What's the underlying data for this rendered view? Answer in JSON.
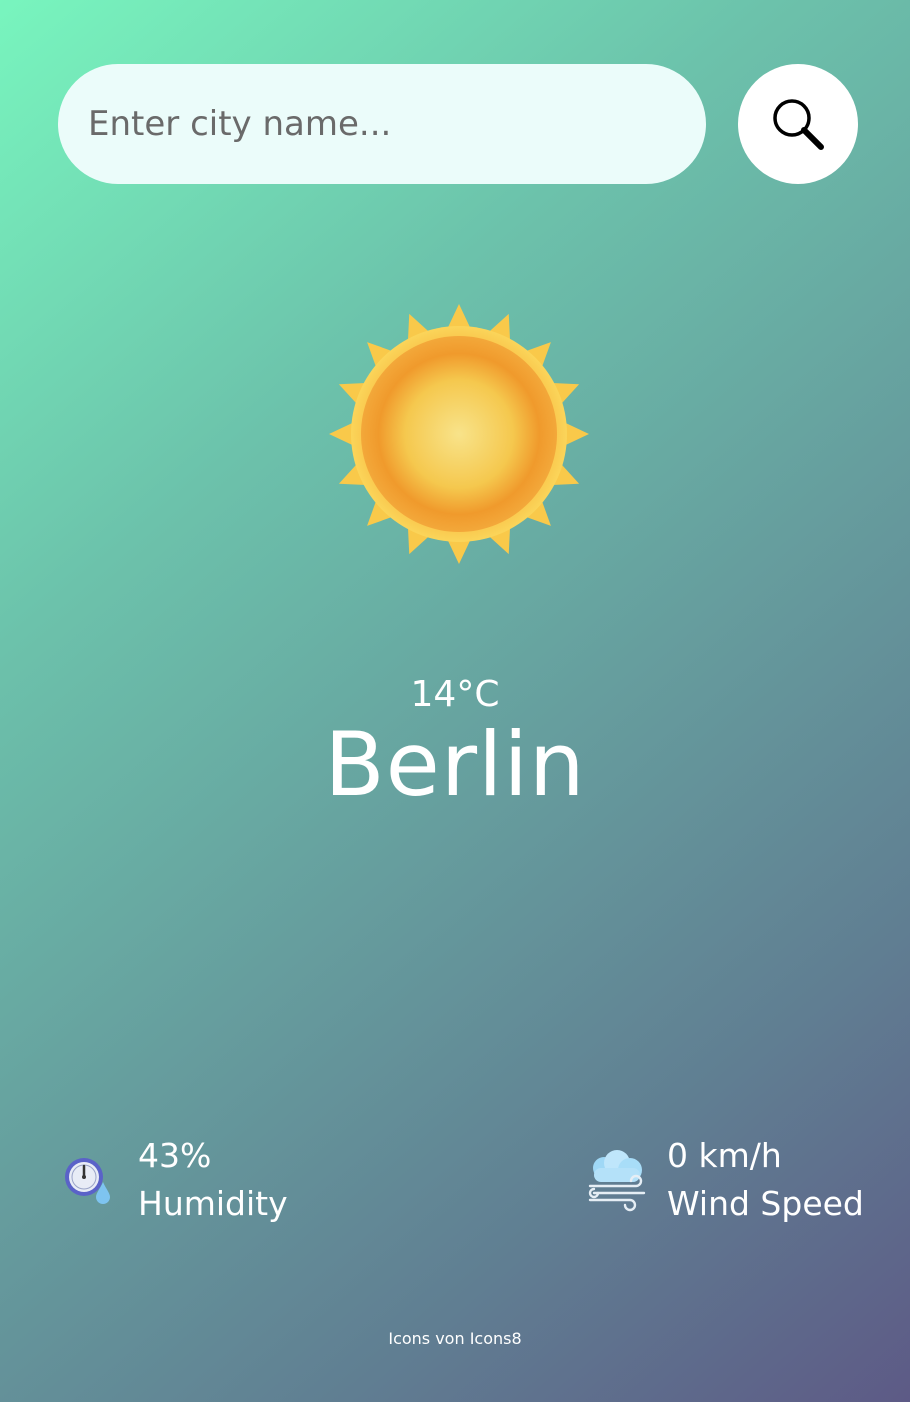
{
  "search": {
    "placeholder": "Enter city name...",
    "value": "",
    "button_icon": "search-icon"
  },
  "weather": {
    "icon": "sun-icon",
    "temperature": "14°C",
    "city": "Berlin"
  },
  "details": {
    "humidity": {
      "icon": "humidity-icon",
      "value": "43%",
      "label": "Humidity"
    },
    "wind": {
      "icon": "wind-icon",
      "value": "0 km/h",
      "label": "Wind Speed"
    }
  },
  "footer": {
    "credit": "Icons von Icons8"
  },
  "colors": {
    "gradient_start": "#78f5be",
    "gradient_end": "#5d5a86",
    "search_field_bg": "#ebfcfa",
    "search_button_bg": "#ffffff",
    "text": "#ffffff"
  }
}
